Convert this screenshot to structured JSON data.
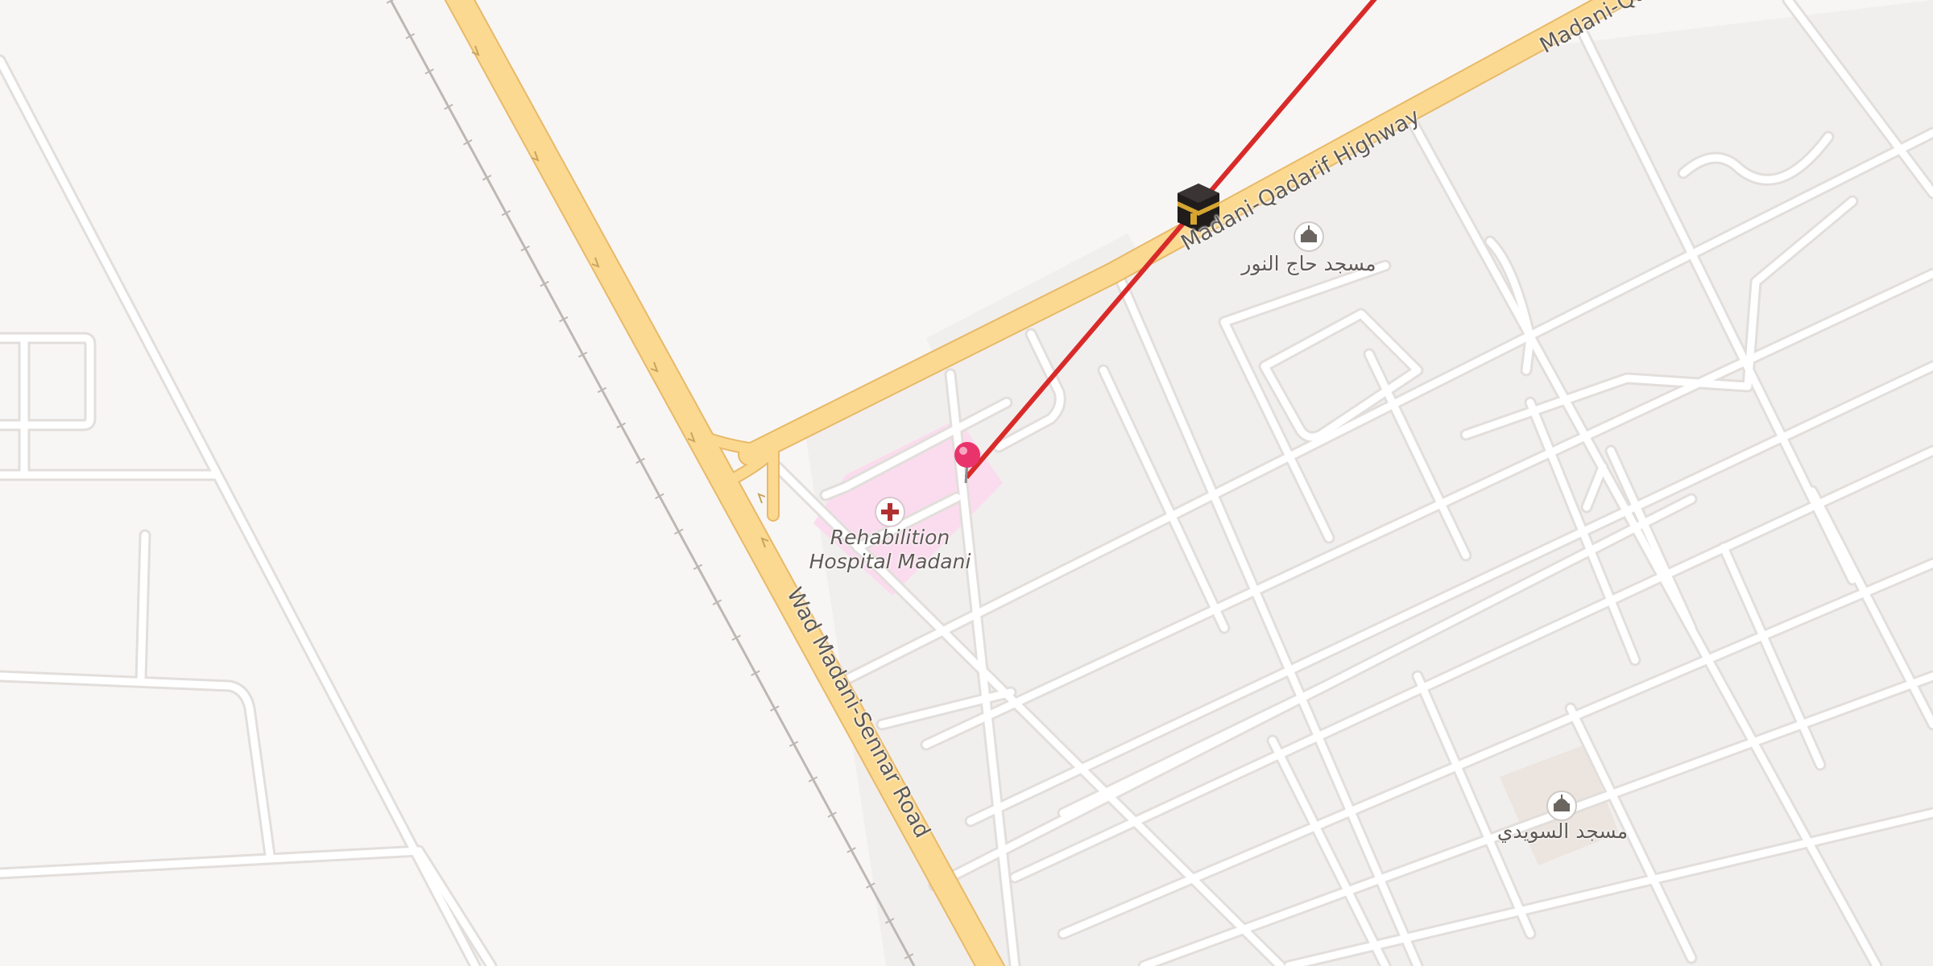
{
  "map": {
    "style": "light street map",
    "colors": {
      "background": "#f8f6f4",
      "block": "#f1efed",
      "minor_road": "#ffffff",
      "minor_road_casing": "#e2dedb",
      "highway": "#fbd990",
      "highway_casing": "#e8b96a",
      "hospital_area": "#fbdcee",
      "mosque_area": "#ebe4df",
      "qibla_line": "#d92a2a",
      "pin": "#e8336d",
      "railway": "#b9b4b0"
    },
    "roads": [
      {
        "id": "madani-sennar",
        "name": "Wad Madani-Sennar Road",
        "type": "primary"
      },
      {
        "id": "madani-qadarif",
        "name": "Madani-Qadarif Highway",
        "name_fragment_top": "Madani-Qa",
        "type": "primary"
      }
    ],
    "pois": [
      {
        "id": "hospital",
        "name": "Rehabilition Hospital Madani",
        "name_line1": "Rehabilition",
        "name_line2": "Hospital Madani",
        "icon": "hospital-cross-icon"
      },
      {
        "id": "mosque-1",
        "name": "مسجد حاج النور",
        "icon": "mosque-icon"
      },
      {
        "id": "mosque-2",
        "name": "مسجد السويدي",
        "icon": "mosque-icon"
      }
    ],
    "markers": [
      {
        "id": "dropped-pin",
        "icon": "pushpin-icon",
        "color": "#e8336d"
      },
      {
        "id": "kaaba",
        "icon": "kaaba-icon"
      }
    ],
    "overlay": {
      "type": "qibla direction line",
      "color": "#d92a2a"
    }
  }
}
